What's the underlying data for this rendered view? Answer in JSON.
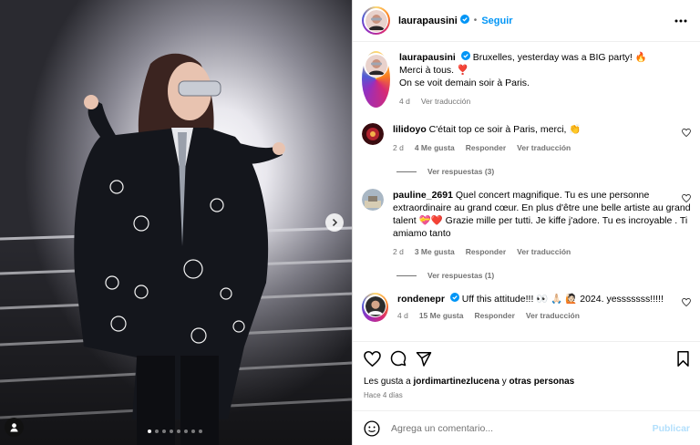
{
  "post": {
    "author": "laurapausini",
    "follow_label": "Seguir",
    "separator": "•",
    "caption_line1": "Bruxelles, yesterday was a BIG party! 🔥",
    "caption_line2": "Merci à tous. ❣️",
    "caption_line3": "On se voit demain soir à Paris.",
    "caption_age": "4 d",
    "caption_translate": "Ver traducción"
  },
  "comments": [
    {
      "user": "lilidoyo",
      "text": "C'était top ce soir à Paris, merci, 👏",
      "age": "2 d",
      "likes": "4 Me gusta",
      "reply": "Responder",
      "translate": "Ver traducción",
      "replies": "Ver respuestas (3)",
      "verified": false
    },
    {
      "user": "pauline_2691",
      "text": "Quel concert magnifique. Tu es une personne extraordinaire au grand cœur. En plus d'être une belle artiste au grand talent 💝❤️ Grazie mille per tutti. Je kiffe j'adore. Tu es incroyable . Ti amiamo tanto",
      "age": "2 d",
      "likes": "3 Me gusta",
      "reply": "Responder",
      "translate": "Ver traducción",
      "replies": "Ver respuestas (1)",
      "verified": false
    },
    {
      "user": "rondenepr",
      "text": "Uff this attitude!!! 👀 🙏🏻 🙋🏻 2024. yesssssss!!!!!",
      "age": "4 d",
      "likes": "15 Me gusta",
      "reply": "Responder",
      "translate": "Ver traducción",
      "verified": true
    }
  ],
  "likes_prefix": "Les gusta a",
  "likes_user": "jordimartinezlucena",
  "likes_suffix": "y",
  "likes_others": "otras personas",
  "posted_ago": "Hace 4 días",
  "comment_input": {
    "placeholder": "Agrega un comentario...",
    "publish_label": "Publicar"
  },
  "carousel": {
    "slides": 8,
    "active": 1
  },
  "icons": [
    "heart-icon",
    "comment-icon",
    "share-icon",
    "bookmark-icon",
    "more-icon",
    "emoji-icon",
    "chevron-right-icon",
    "tag-user-icon",
    "verified-icon"
  ],
  "colors": {
    "accent": "#0095f6",
    "verified": "#0095f6",
    "muted": "#737373",
    "publish_disabled": "#b2dffc"
  }
}
